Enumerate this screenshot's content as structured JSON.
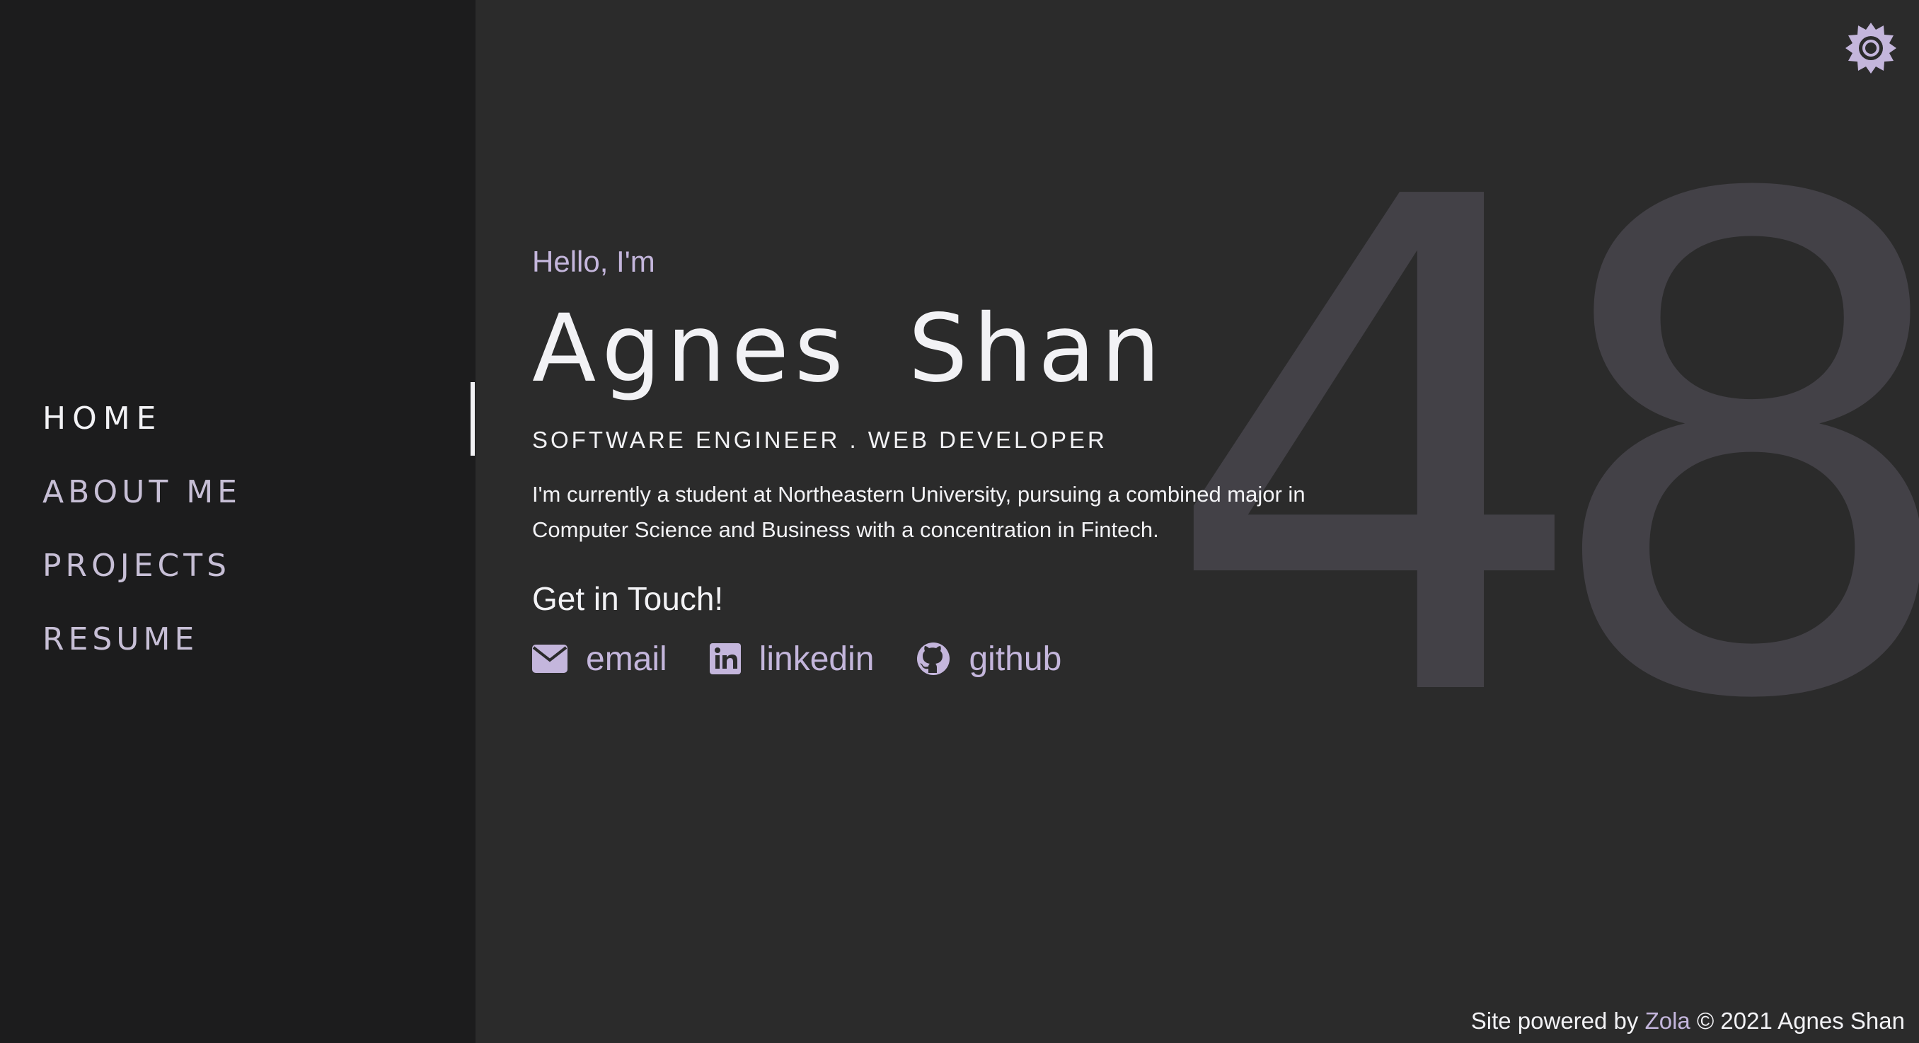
{
  "sidebar": {
    "items": [
      {
        "label": "HOME",
        "active": true
      },
      {
        "label": "ABOUT ME"
      },
      {
        "label": "PROJECTS"
      },
      {
        "label": "RESUME"
      }
    ]
  },
  "theme_toggle": {
    "icon": "gear-icon"
  },
  "background_number": "48",
  "hero": {
    "greeting": "Hello, I'm",
    "name": "Agnes Shan",
    "role": "SOFTWARE ENGINEER . WEB DEVELOPER",
    "bio": "I'm currently a student at Northeastern University, pursuing a combined major in Computer Science and Business with a concentration in Fintech.",
    "contact_heading": "Get in Touch!",
    "links": [
      {
        "label": "email",
        "icon": "envelope-icon"
      },
      {
        "label": "linkedin",
        "icon": "linkedin-icon"
      },
      {
        "label": "github",
        "icon": "github-icon"
      }
    ]
  },
  "footer": {
    "prefix": "Site powered by",
    "link": "Zola",
    "suffix": "© 2021 Agnes Shan"
  },
  "colors": {
    "accent": "#c4b6dc",
    "text": "#f2f2f5",
    "sidebar_bg": "#1c1c1d",
    "main_bg": "#2b2b2b",
    "watermark": "#434147"
  }
}
